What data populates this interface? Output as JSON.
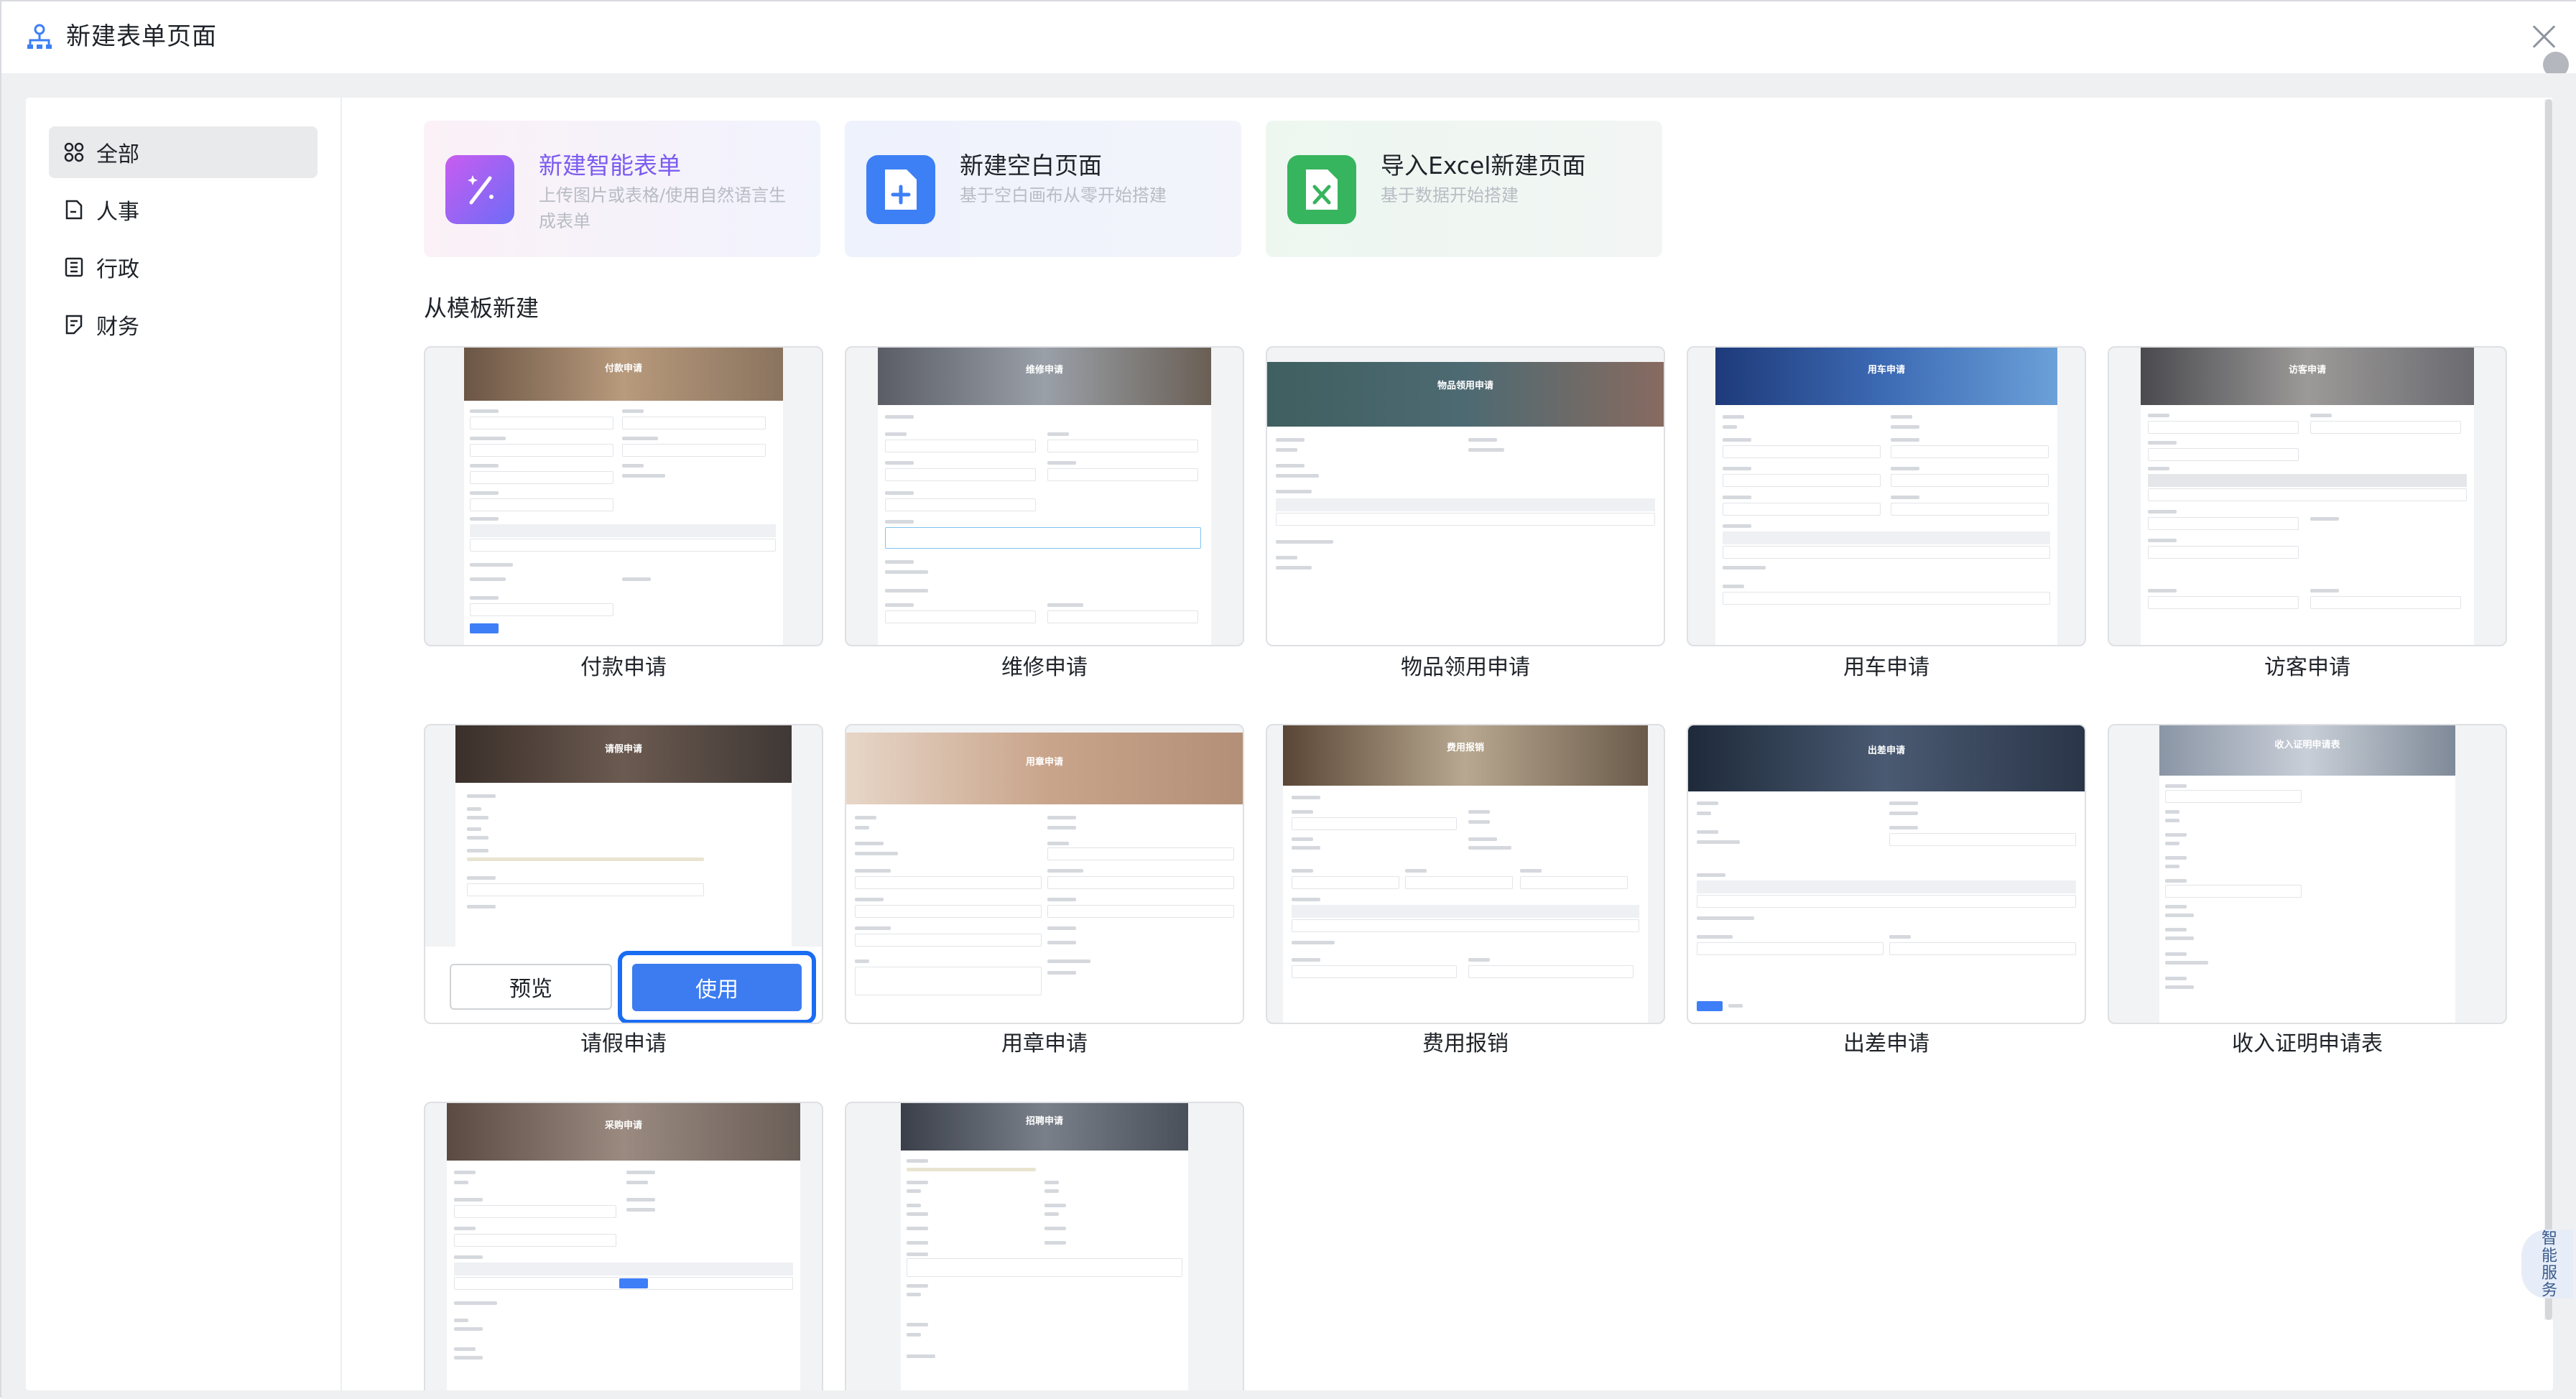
{
  "window": {
    "title": "新建表单页面",
    "icon": "org-chart-icon",
    "close_icon": "close-icon"
  },
  "sidebar": {
    "items": [
      {
        "label": "全部",
        "icon": "grid-icon",
        "active": true
      },
      {
        "label": "人事",
        "icon": "document-icon",
        "active": false
      },
      {
        "label": "行政",
        "icon": "building-icon",
        "active": false
      },
      {
        "label": "财务",
        "icon": "finance-doc-icon",
        "active": false
      }
    ]
  },
  "create_options": [
    {
      "title": "新建智能表单",
      "desc": "上传图片或表格/使用自然语言生成表单",
      "icon": "magic-wand-icon",
      "accent": "#7b5cf0"
    },
    {
      "title": "新建空白页面",
      "desc": "基于空白画布从零开始搭建",
      "icon": "new-page-icon",
      "accent": "#3d7ff5"
    },
    {
      "title": "导入Excel新建页面",
      "desc": "基于数据开始搭建",
      "icon": "excel-icon",
      "accent": "#37b45e"
    }
  ],
  "templates_section": {
    "title": "从模板新建",
    "templates": [
      {
        "name": "付款申请",
        "banner_title": "付款申请"
      },
      {
        "name": "维修申请",
        "banner_title": "维修申请"
      },
      {
        "name": "物品领用申请",
        "banner_title": "物品领用申请"
      },
      {
        "name": "用车申请",
        "banner_title": "用车申请"
      },
      {
        "name": "访客申请",
        "banner_title": "访客申请"
      },
      {
        "name": "请假申请",
        "banner_title": "请假申请"
      },
      {
        "name": "用章申请",
        "banner_title": "用章申请"
      },
      {
        "name": "费用报销",
        "banner_title": "费用报销"
      },
      {
        "name": "出差申请",
        "banner_title": "出差申请"
      },
      {
        "name": "收入证明申请表",
        "banner_title": "收入证明申请表"
      },
      {
        "name": "采购申请",
        "banner_title": "采购申请"
      },
      {
        "name": "招聘申请",
        "banner_title": "招聘申请"
      }
    ],
    "hover_actions": {
      "preview": "预览",
      "use": "使用"
    }
  },
  "assistant": {
    "label": "智能服务"
  }
}
